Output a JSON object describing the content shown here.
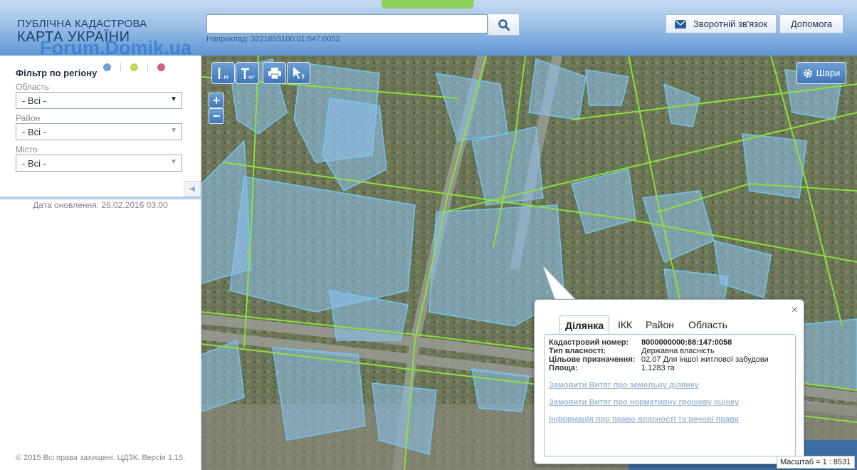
{
  "header": {
    "logo_line1": "ПУБЛІЧНА КАДАСТРОВА",
    "logo_line2": "КАРТА УКРАЇНИ",
    "watermark": "Forum.Domik.ua",
    "search_value": "",
    "search_hint": "Наприклад: 3221655100:01:047:0052",
    "feedback_label": "Зворотній зв'язок",
    "help_label": "Допомога",
    "feedback_icon": "envelope-icon",
    "search_icon": "magnifier-icon"
  },
  "sidebar": {
    "filter_title": "Фільтр по регіону",
    "dot_colors": [
      "#6e9fd3",
      "#c8d45a",
      "#d4607e"
    ],
    "region_label": "Область",
    "region_value": "- Всі -",
    "district_label": "Район",
    "district_value": "- Всі -",
    "city_label": "Місто",
    "city_value": "- Всі -",
    "update_date": "Дата оновлення: 26.02.2016 03:00",
    "copyright": "© 2015 Всі права захищені. ЦДЗК. Версія 1.15."
  },
  "map": {
    "toolbar": [
      "measure-length-icon",
      "measure-area-icon",
      "print-icon",
      "info-cursor-icon"
    ],
    "measure_length_unit": "м",
    "measure_area_unit": "м²",
    "zoom_in": "+",
    "zoom_out": "−",
    "layers_label": "Шари",
    "scale": "Масштаб = 1 : 8531"
  },
  "popup": {
    "tabs": [
      "Ділянка",
      "ІКК",
      "Район",
      "Область"
    ],
    "close": "×",
    "rows": [
      {
        "label": "Кадастровий номер:",
        "value": "8000000000:88:147:0058"
      },
      {
        "label": "Тип власності:",
        "value": "Державна власність"
      },
      {
        "label": "Цільове призначення:",
        "value": "02.07 Для іншої житлової забудови"
      },
      {
        "label": "Площа:",
        "value": "1.1283 га"
      }
    ],
    "links": [
      "Замовити Витяг про земельну ділянку",
      "Замовити Витяг про нормативну грошову оцінку",
      "Інформація про право власності та речові права"
    ]
  },
  "colors": {
    "parcel_fill": "#8ec3f0",
    "parcel_stroke": "#6fc6f2",
    "boundary_line": "#8be23a",
    "header_top": "#c7dbf2",
    "header_bottom": "#5f96d3"
  }
}
